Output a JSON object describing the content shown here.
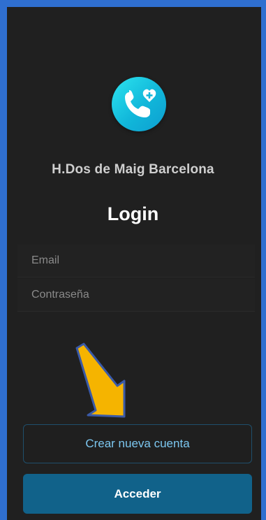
{
  "app": {
    "hospital_name": "H.Dos de Maig Barcelona",
    "login_title": "Login"
  },
  "logo": {
    "icon": "phone-with-heart-icon",
    "gradient_start": "#2de4ef",
    "gradient_end": "#0d9ed0"
  },
  "form": {
    "email": {
      "value": "",
      "placeholder": "Email"
    },
    "password": {
      "value": "",
      "placeholder": "Contraseña"
    }
  },
  "buttons": {
    "create_account_label": "Crear nueva cuenta",
    "login_label": "Acceder"
  },
  "annotation": {
    "icon": "arrow-down-left-icon",
    "color": "#f5b400"
  },
  "colors": {
    "background": "#202020",
    "frame": "#2f6fd0",
    "primary": "#11628a",
    "accent_text": "#7cc7f0"
  }
}
